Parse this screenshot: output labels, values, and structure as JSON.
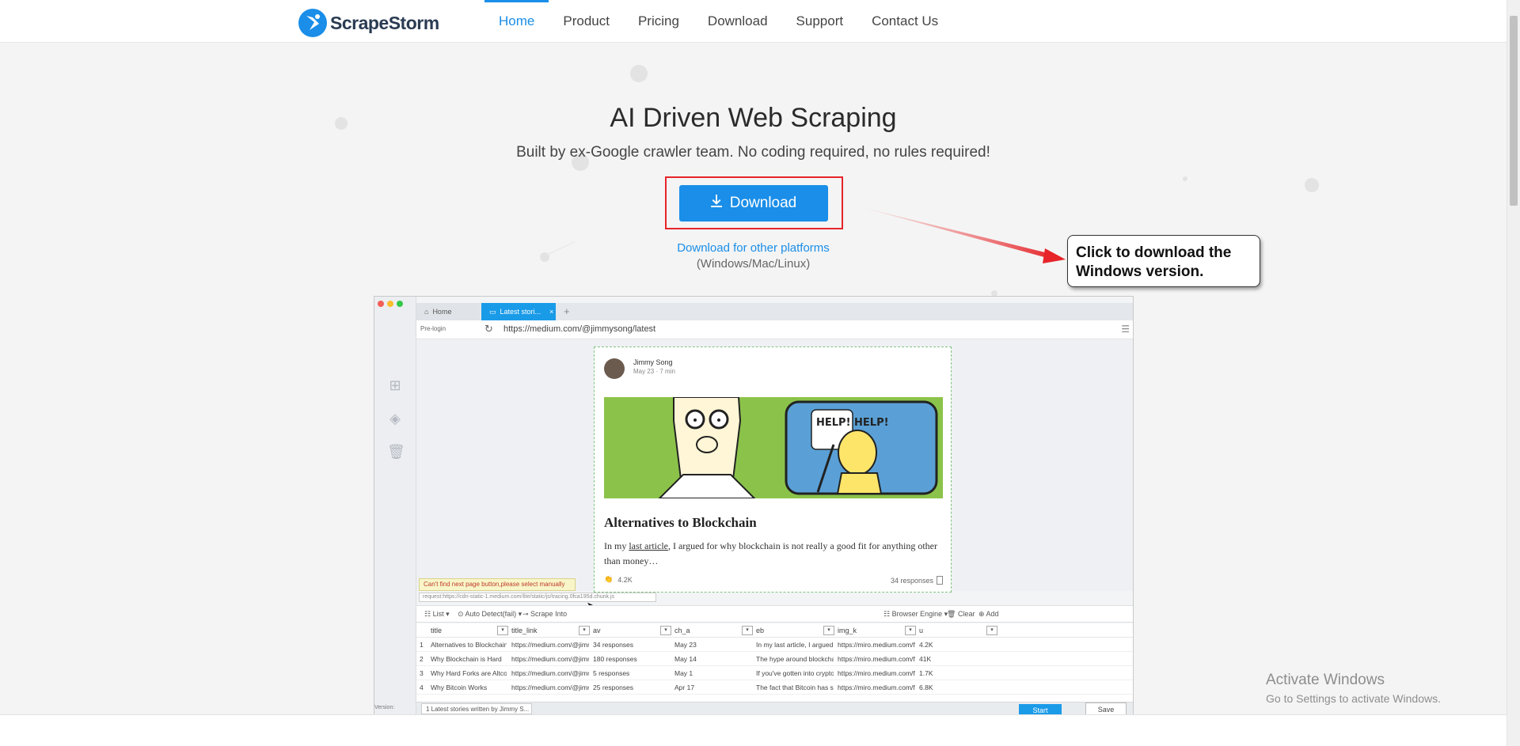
{
  "brand": {
    "name": "ScrapeStorm"
  },
  "nav": {
    "items": [
      {
        "label": "Home",
        "active": true
      },
      {
        "label": "Product"
      },
      {
        "label": "Pricing"
      },
      {
        "label": "Download"
      },
      {
        "label": "Support"
      },
      {
        "label": "Contact Us"
      }
    ]
  },
  "hero": {
    "title": "AI Driven Web Scraping",
    "subtitle": "Built by ex-Google crawler team. No coding required, no rules required!",
    "download_label": "Download",
    "other_link": "Download for other platforms",
    "other_platforms": "(Windows/Mac/Linux)"
  },
  "callout": {
    "text": "Click to download the Windows version."
  },
  "app": {
    "tabs": {
      "home": "Home",
      "active": "Latest stori...",
      "close": "×",
      "plus": "+"
    },
    "address": {
      "prelogin": "Pre-login",
      "url": "https://medium.com/@jimmysong/latest"
    },
    "article": {
      "author": "Jimmy Song",
      "date": "May 23 · 7 min",
      "title": "Alternatives to Blockchain",
      "text_before": "In my ",
      "text_link": "last article",
      "text_after": ", I argued for why blockchain is not really a good fit for anything other than money…",
      "claps": "4.2K",
      "responses": "34 responses",
      "comic_text": "HELP! HELP!"
    },
    "warning": "Can't find next page button,please select manually",
    "request": "request:https://cdn-static-1.medium.com/lite/static/js/tracing.0fca195d.chunk.js",
    "toolbar": {
      "list": "List ▾",
      "auto_detect": "Auto Detect(fail) ▾",
      "scrape_into": "Scrape Into",
      "browser_engine": "Browser Engine ▾",
      "clear": "Clear",
      "add": "Add"
    },
    "columns": [
      "title",
      "title_link",
      "av",
      "ch_a",
      "eb",
      "img_k",
      "u"
    ],
    "rows": [
      {
        "n": "1",
        "cells": [
          "Alternatives to Blockchain",
          "https://medium.com/@jimmys...",
          "34 responses",
          "May 23",
          "In my last article, I argued for w...",
          "https://miro.medium.com/fit/c...",
          "4.2K"
        ]
      },
      {
        "n": "2",
        "cells": [
          "Why Blockchain is Hard",
          "https://medium.com/@jimmys...",
          "180 responses",
          "May 14",
          "The hype around blockchain is...",
          "https://miro.medium.com/fit/c...",
          "41K"
        ]
      },
      {
        "n": "3",
        "cells": [
          "Why Hard Forks are Altcoins",
          "https://medium.com/@jimmys...",
          "5 responses",
          "May 1",
          "If you've gotten into crypto in t...",
          "https://miro.medium.com/fit/c...",
          "1.7K"
        ]
      },
      {
        "n": "4",
        "cells": [
          "Why Bitcoin Works",
          "https://medium.com/@jimmys...",
          "25 responses",
          "Apr 17",
          "The fact that Bitcoin has succe...",
          "https://miro.medium.com/fit/c...",
          "6.8K"
        ]
      }
    ],
    "footer": {
      "chip": "1 Latest stories written by Jimmy S...",
      "start": "Start",
      "save": "Save",
      "version": "Version:"
    }
  },
  "watermark": {
    "title": "Activate Windows",
    "subtitle": "Go to Settings to activate Windows."
  },
  "colors": {
    "accent": "#1a8ee8",
    "highlight": "#e62429"
  }
}
